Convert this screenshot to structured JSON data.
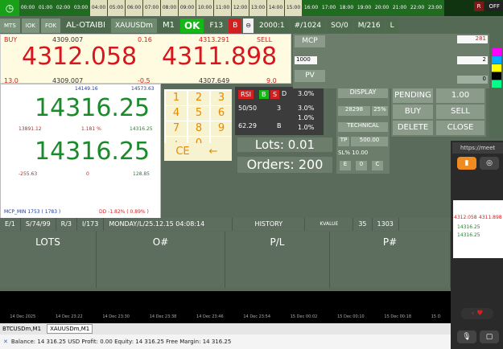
{
  "timeline": {
    "hours": [
      "00:00",
      "01:00",
      "02:00",
      "03:00",
      "04:00",
      "05:00",
      "06:00",
      "07:00",
      "08:00",
      "09:00",
      "10:00",
      "11:00",
      "12:00",
      "13:00",
      "14:00",
      "15:00",
      "16:00",
      "17:00",
      "18:00",
      "19:00",
      "20:00",
      "21:00",
      "22:00",
      "23:00"
    ],
    "r_label": "R",
    "off_label": "OFF"
  },
  "topbar": {
    "mts": "MTS",
    "iok": "IOK",
    "fok": "FOK",
    "name": "AL-OTAIBI",
    "symbol": "XAUUSDm",
    "timeframe": "M1",
    "ok": "OK",
    "f13": "F13",
    "b_icon": "B",
    "fl_icon": "⊖",
    "stat1": "2000:1",
    "stat2": "#/1024",
    "stat3": "SO/0",
    "stat4": "M/216",
    "l": "L"
  },
  "quote": {
    "buy": "BUY",
    "sell": "SELL",
    "bid_open": "4309.007",
    "spread_small": "0.16",
    "ask_open": "4313.291",
    "buy_price": "4312.058",
    "sell_price": "4311.898",
    "left_13": "13.0",
    "bid_low": "4309.007",
    "change": "-0.5",
    "ask_low": "4307.649",
    "right_9": "9.0"
  },
  "left_panel": {
    "top_a": "14149.16",
    "top_b": "14573.63",
    "equity_big": "14316.25",
    "m1": "13891.12",
    "m_pct": "1.181 %",
    "m2": "14316.25",
    "balance_big": "14316.25",
    "b1": "-255.63",
    "b_zero": "0",
    "b2": "128.85",
    "mcp_min": "MCP_MIN 1753 ( 1783 )",
    "dd": "DD -1.82% ( 0.89% )",
    "pips": "0.0 pips"
  },
  "keypad": {
    "keys": [
      "1",
      "2",
      "3",
      "4",
      "5",
      "6",
      "7",
      "8",
      "9",
      ":",
      "0",
      "."
    ],
    "ce": "CE",
    "back": "←"
  },
  "rsi": {
    "rsi": "RSI",
    "b": "B",
    "s": "S",
    "d": "D",
    "p1": "3.0%",
    "p2": "3.0%",
    "p3": "1.0%",
    "ratio": "50/50",
    "r3": "3",
    "v": "62.29",
    "vb": "B",
    "p4": "1.0%"
  },
  "mcp_area": {
    "mcp": "MCP",
    "v1000": "1000",
    "pv": "PV",
    "r281": "281",
    "r2": "2",
    "r0": "0"
  },
  "right_buttons": {
    "display": "DISPLAY",
    "num": "28298",
    "pct": "25%",
    "technical": "TECHNICAL",
    "pending": "PENDING",
    "val": "1.00",
    "buy": "BUY",
    "sell": "SELL",
    "delete": "DELETE",
    "close": "CLOSE"
  },
  "lots": {
    "label": "Lots: 0.01",
    "small": "0.01"
  },
  "orders": {
    "label": "Orders: 200"
  },
  "tp": {
    "tp": "TP",
    "tp_val": "500.00",
    "sl": "SL% 10.00",
    "e": "E",
    "zero": "0",
    "c": "C"
  },
  "infobar": {
    "e1": "E/1",
    "s1": "S/74/99",
    "r3": "R/3",
    "i173": "I/173",
    "date": "MONDAY/L/25.12.15 04:08:14",
    "history": "HISTORY",
    "kvalue": "KVALUE",
    "n35": "35",
    "n130": "1303"
  },
  "columns": {
    "lots": "LOTS",
    "order": "O#",
    "pl": "P/L",
    "p": "P#"
  },
  "dates": [
    "14 Dec 2025",
    "14 Dec 23:22",
    "14 Dec 23:30",
    "14 Dec 23:38",
    "14 Dec 23:46",
    "14 Dec 23:54",
    "15 Dec 00:02",
    "15 Dec 00:10",
    "15 Dec 00:18",
    "15 D"
  ],
  "tabs": {
    "t1": "BTCUSDm,M1",
    "t2": "XAUUSDm,M1"
  },
  "status": {
    "text": "Balance: 14 316.25 USD  Profit: 0.00  Equity: 14 316.25  Free Margin: 14 316.25"
  },
  "overlay": {
    "url": "https://meet",
    "thumb_a": "4312.058",
    "thumb_b": "4311.898",
    "thumb_c": "14316.25",
    "thumb_d": "14316.25"
  },
  "colors": {
    "red": "#d8161e",
    "green": "#1a8a2a",
    "ok": "#17b617"
  }
}
